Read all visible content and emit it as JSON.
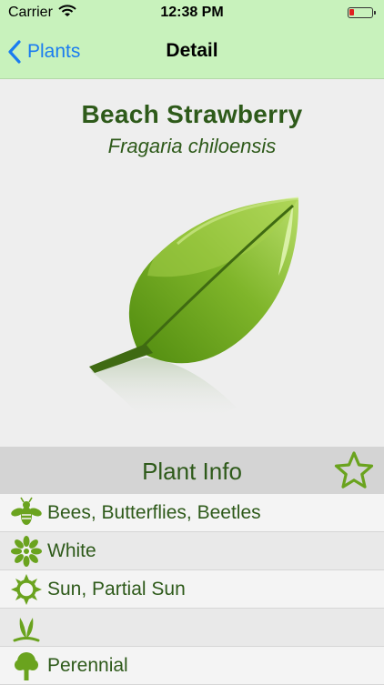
{
  "status_bar": {
    "carrier": "Carrier",
    "time": "12:38 PM"
  },
  "nav": {
    "back_label": "Plants",
    "title": "Detail"
  },
  "plant": {
    "common_name": "Beach Strawberry",
    "scientific_name": "Fragaria chiloensis"
  },
  "info": {
    "title": "Plant Info",
    "rows": [
      {
        "icon": "bee-icon",
        "text": "Bees, Butterflies, Beetles"
      },
      {
        "icon": "flower-icon",
        "text": "White"
      },
      {
        "icon": "sun-icon",
        "text": "Sun, Partial Sun"
      },
      {
        "icon": "sprout-icon",
        "text": ""
      },
      {
        "icon": "tree-icon",
        "text": "Perennial"
      }
    ]
  },
  "colors": {
    "accent_green": "#6aa31e",
    "text_green": "#2e5a1a",
    "nav_bg": "#c8f2bc",
    "link_blue": "#1a7cf0"
  }
}
